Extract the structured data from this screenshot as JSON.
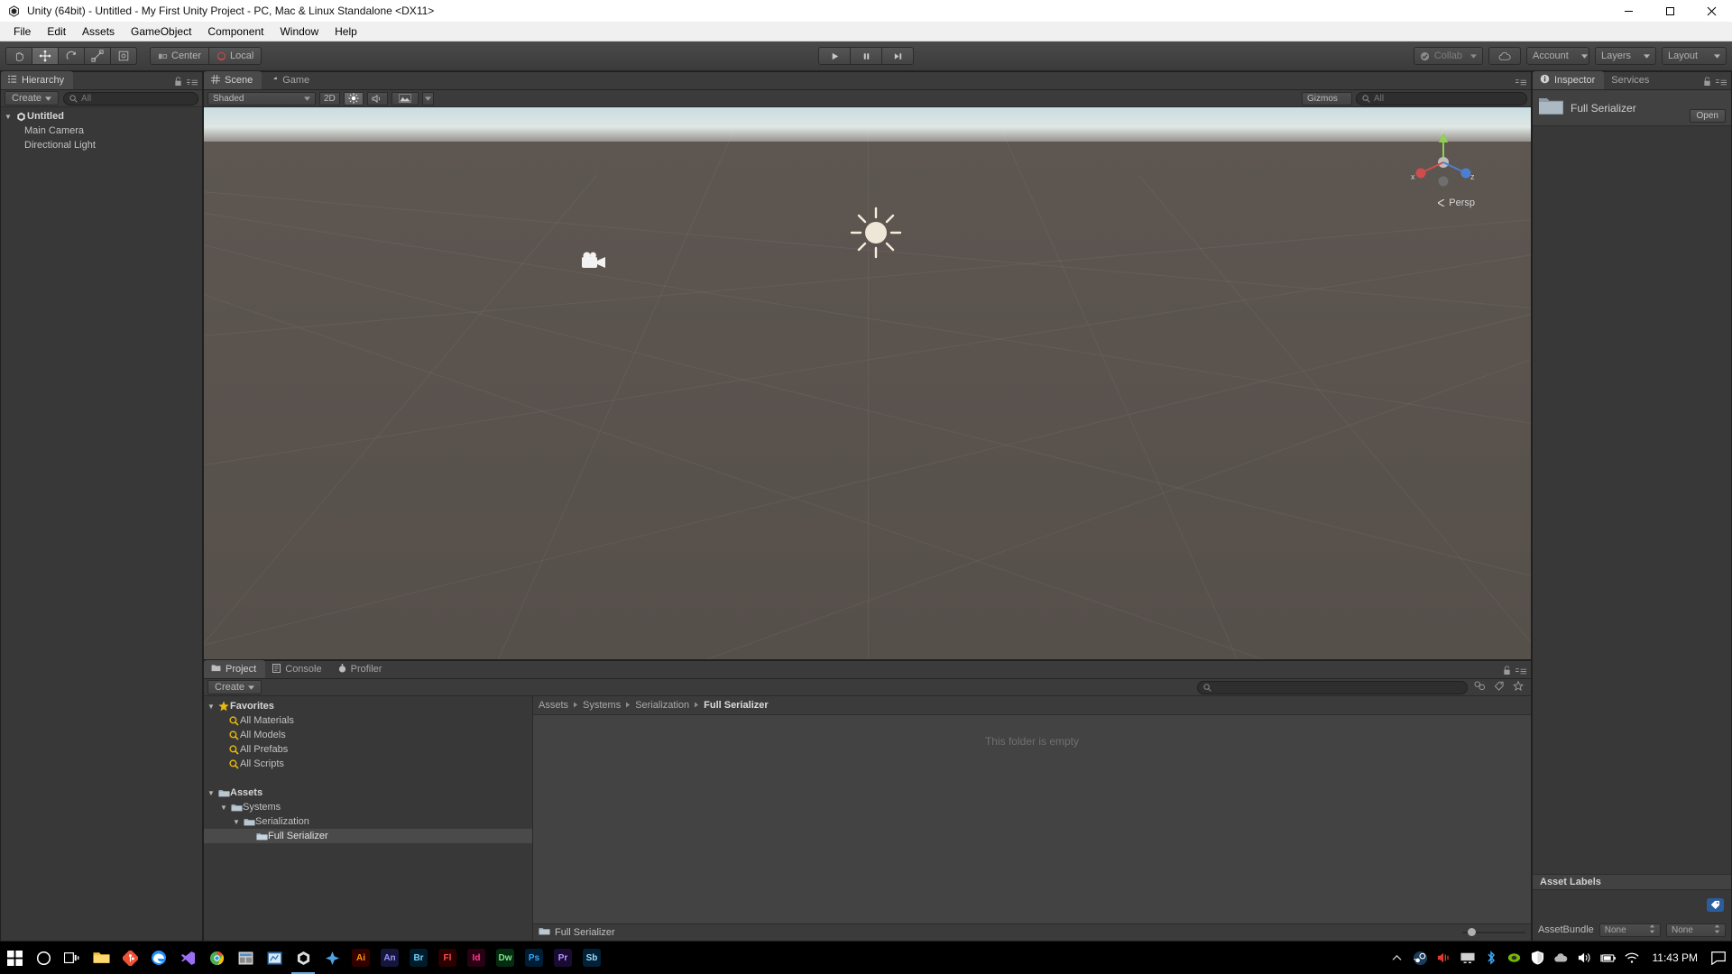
{
  "window": {
    "title": "Unity (64bit) - Untitled - My First Unity Project - PC, Mac & Linux Standalone <DX11>",
    "icon": "unity-icon",
    "minimize": "minimize-button",
    "maximize": "maximize-button",
    "close": "close-button"
  },
  "menubar": {
    "items": [
      "File",
      "Edit",
      "Assets",
      "GameObject",
      "Component",
      "Window",
      "Help"
    ]
  },
  "toolbar": {
    "transform_tools": [
      {
        "name": "hand-tool",
        "glyph": "✋",
        "active": false
      },
      {
        "name": "move-tool",
        "glyph": "✥",
        "active": true
      },
      {
        "name": "rotate-tool",
        "glyph": "↻",
        "active": false
      },
      {
        "name": "scale-tool",
        "glyph": "⤢",
        "active": false
      },
      {
        "name": "rect-tool",
        "glyph": "▣",
        "active": false
      }
    ],
    "pivot_mode": "Center",
    "pivot_rotation": "Local",
    "play": "▶",
    "pause": "❙❙",
    "step": "▶❙",
    "collab": "Collab",
    "cloud": "cloud-icon",
    "account": "Account",
    "layers": "Layers",
    "layout": "Layout"
  },
  "hierarchy": {
    "tab": "Hierarchy",
    "create_label": "Create",
    "search_placeholder": "All",
    "items": [
      {
        "label": "Untitled",
        "depth": 0,
        "bold": true,
        "icon": "unity-scene-icon",
        "fold": "▼"
      },
      {
        "label": "Main Camera",
        "depth": 1,
        "bold": false,
        "icon": "",
        "fold": ""
      },
      {
        "label": "Directional Light",
        "depth": 1,
        "bold": false,
        "icon": "",
        "fold": ""
      }
    ]
  },
  "scene": {
    "tabs": [
      {
        "label": "Scene",
        "active": true,
        "icon": "grid-icon"
      },
      {
        "label": "Game",
        "active": false,
        "icon": "gamepad-icon"
      }
    ],
    "draw_mode": "Shaded",
    "mode_2d": "2D",
    "lighting_icon": "sun-icon",
    "audio_icon": "audio-icon",
    "effects_icon": "effects-icon",
    "gizmos": "Gizmos",
    "gizmo_search_placeholder": "All",
    "perspective_label": "Persp",
    "axis_x": "x",
    "axis_y": "y",
    "axis_z": "z",
    "camera_gizmo": "camera-gizmo",
    "light_gizmo": "light-gizmo"
  },
  "project": {
    "tabs": [
      {
        "label": "Project",
        "active": true,
        "icon": "folder-icon"
      },
      {
        "label": "Console",
        "active": false,
        "icon": "console-icon"
      },
      {
        "label": "Profiler",
        "active": false,
        "icon": "profiler-icon"
      }
    ],
    "create_label": "Create",
    "search_placeholder": "",
    "tree": [
      {
        "label": "Favorites",
        "depth": 0,
        "bold": true,
        "icon": "star-icon",
        "fold": "▼",
        "selected": false
      },
      {
        "label": "All Materials",
        "depth": 1,
        "bold": false,
        "icon": "search-icon",
        "fold": "",
        "selected": false
      },
      {
        "label": "All Models",
        "depth": 1,
        "bold": false,
        "icon": "search-icon",
        "fold": "",
        "selected": false
      },
      {
        "label": "All Prefabs",
        "depth": 1,
        "bold": false,
        "icon": "search-icon",
        "fold": "",
        "selected": false
      },
      {
        "label": "All Scripts",
        "depth": 1,
        "bold": false,
        "icon": "search-icon",
        "fold": "",
        "selected": false
      },
      {
        "label": "",
        "depth": 0,
        "bold": false,
        "icon": "",
        "fold": "",
        "selected": false
      },
      {
        "label": "Assets",
        "depth": 0,
        "bold": true,
        "icon": "folder-icon",
        "fold": "▼",
        "selected": false
      },
      {
        "label": "Systems",
        "depth": 1,
        "bold": false,
        "icon": "folder-icon",
        "fold": "▼",
        "selected": false
      },
      {
        "label": "Serialization",
        "depth": 2,
        "bold": false,
        "icon": "folder-icon",
        "fold": "▼",
        "selected": false
      },
      {
        "label": "Full Serializer",
        "depth": 3,
        "bold": false,
        "icon": "folder-icon",
        "fold": "",
        "selected": true
      }
    ],
    "breadcrumb": [
      "Assets",
      "Systems",
      "Serialization",
      "Full Serializer"
    ],
    "empty_message": "This folder is empty",
    "status_label": "Full Serializer"
  },
  "inspector": {
    "tabs": [
      {
        "label": "Inspector",
        "active": true,
        "icon": "info-icon"
      },
      {
        "label": "Services",
        "active": false,
        "icon": ""
      }
    ],
    "asset_name": "Full Serializer",
    "asset_icon": "folder-icon",
    "open_button": "Open",
    "asset_labels_header": "Asset Labels",
    "tag_icon": "label-tag-icon",
    "assetbundle_label": "AssetBundle",
    "assetbundle_value": "None",
    "assetbundle_variant": "None"
  },
  "taskbar": {
    "items": [
      {
        "name": "start-button",
        "glyph": "⊞",
        "color": "#ffffff",
        "bg": ""
      },
      {
        "name": "cortana-search-icon",
        "glyph": "○",
        "color": "#ffffff",
        "bg": ""
      },
      {
        "name": "task-view-icon",
        "glyph": "❑",
        "color": "#ffffff",
        "bg": ""
      },
      {
        "name": "file-explorer-icon",
        "glyph": "▭",
        "color": "#ffc83d",
        "bg": ""
      },
      {
        "name": "git-icon",
        "glyph": "⑂",
        "color": "#f05133",
        "bg": ""
      },
      {
        "name": "edge-icon",
        "glyph": "e",
        "color": "#1e90ff",
        "bg": ""
      },
      {
        "name": "visual-studio-icon",
        "glyph": "⯈",
        "color": "#8b5cf6",
        "bg": ""
      },
      {
        "name": "chrome-icon",
        "glyph": "◉",
        "color": "#4285f4",
        "bg": ""
      },
      {
        "name": "app-icon-1",
        "glyph": "▤",
        "color": "#cccccc",
        "bg": ""
      },
      {
        "name": "app-icon-2",
        "glyph": "▦",
        "color": "#4d9fd6",
        "bg": ""
      },
      {
        "name": "unity-taskbar-icon",
        "glyph": "◁",
        "color": "#dddddd",
        "bg": ""
      },
      {
        "name": "app-icon-3",
        "glyph": "✦",
        "color": "#6aa9e0",
        "bg": ""
      },
      {
        "name": "app-icon-4",
        "glyph": "Ai",
        "color": "#ff9a00",
        "bg": "#330000"
      },
      {
        "name": "app-icon-5",
        "glyph": "An",
        "color": "#9999ff",
        "bg": "#16163a"
      },
      {
        "name": "app-icon-6",
        "glyph": "Br",
        "color": "#6fd0ff",
        "bg": "#001b2a"
      },
      {
        "name": "app-icon-7",
        "glyph": "Fl",
        "color": "#ff4f4f",
        "bg": "#2a0000"
      },
      {
        "name": "app-icon-8",
        "glyph": "Id",
        "color": "#ff3d8b",
        "bg": "#2a0014"
      },
      {
        "name": "app-icon-9",
        "glyph": "Dw",
        "color": "#7ee787",
        "bg": "#052b10"
      },
      {
        "name": "app-icon-10",
        "glyph": "Ps",
        "color": "#31a8ff",
        "bg": "#001d33"
      },
      {
        "name": "app-icon-11",
        "glyph": "Pr",
        "color": "#b39aff",
        "bg": "#1a0b33"
      },
      {
        "name": "app-icon-12",
        "glyph": "Sb",
        "color": "#9bdcff",
        "bg": "#022036"
      }
    ],
    "tray": [
      {
        "name": "show-hidden-icons",
        "glyph": "▲"
      },
      {
        "name": "steam-icon",
        "glyph": "⚙"
      },
      {
        "name": "volume-alert-icon",
        "glyph": "◂"
      },
      {
        "name": "display-icon",
        "glyph": "▭"
      },
      {
        "name": "bluetooth-icon",
        "glyph": "ᛗ"
      },
      {
        "name": "nvidia-icon",
        "glyph": "◉"
      },
      {
        "name": "security-shield-icon",
        "glyph": "⛨"
      },
      {
        "name": "onedrive-icon",
        "glyph": "☁"
      },
      {
        "name": "speaker-icon",
        "glyph": "ὐA"
      },
      {
        "name": "battery-icon",
        "glyph": "▬"
      },
      {
        "name": "wifi-icon",
        "glyph": "◠"
      }
    ],
    "clock": "11:43 PM",
    "action_center": "action-center-icon"
  }
}
